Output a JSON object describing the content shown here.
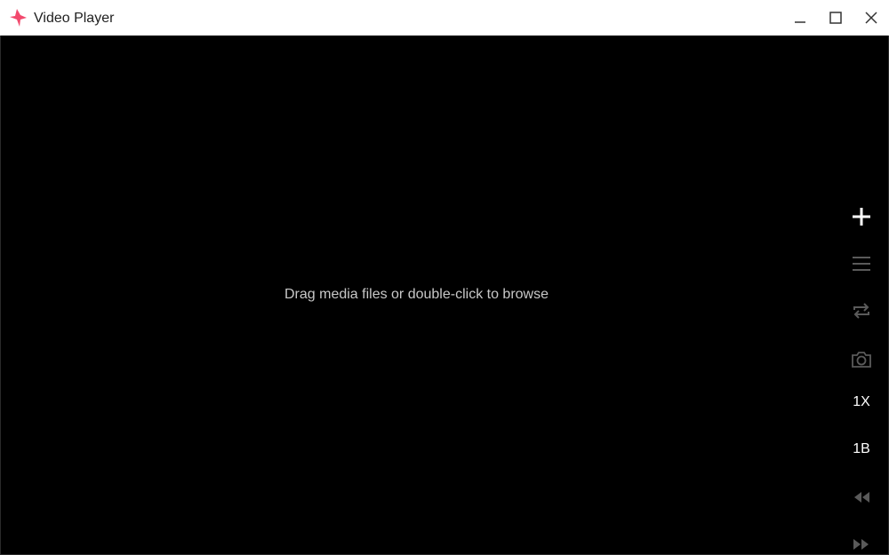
{
  "window": {
    "title": "Video Player",
    "accent_color": "#f2496d",
    "icons": {
      "logo": "app-logo-icon",
      "minimize": "minimize-icon",
      "maximize": "maximize-icon",
      "close": "close-icon"
    }
  },
  "video": {
    "empty_hint": "Drag media files or double-click to browse"
  },
  "sidebar": {
    "add_icon": "plus-icon",
    "playlist_icon": "list-icon",
    "loop_icon": "repeat-icon",
    "snapshot_icon": "camera-icon",
    "speed_label": "1X",
    "b_label": "1B",
    "rewind_icon": "rewind-icon",
    "forward_icon": "fast-forward-icon",
    "active_color": "#ffffff",
    "inactive_color": "#5a5a5a"
  }
}
